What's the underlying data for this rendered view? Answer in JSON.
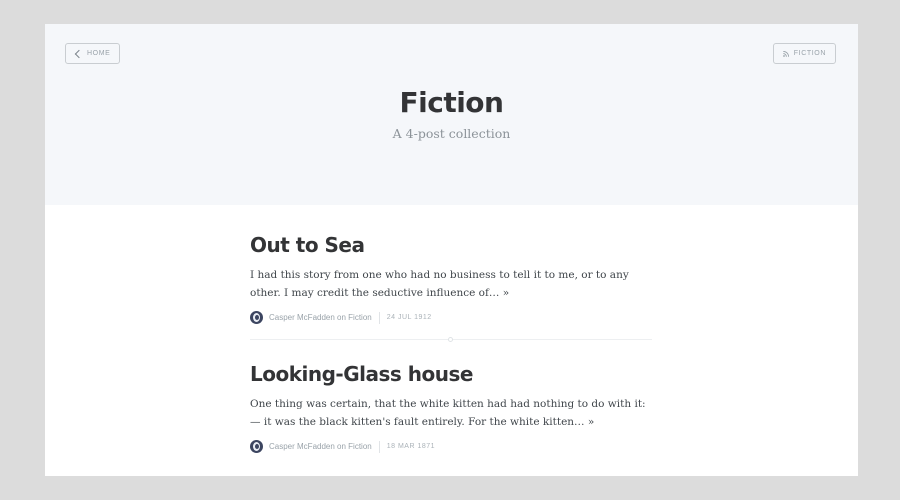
{
  "nav": {
    "home_label": "Home",
    "tag_label": "Fiction"
  },
  "header": {
    "title": "Fiction",
    "description": "A 4-post collection"
  },
  "posts": [
    {
      "title": "Out to Sea",
      "excerpt": "I had this story from one who had no business to tell it to me, or to any other. I may credit the seductive influence of…",
      "more": "»",
      "author_line": "Casper McFadden on Fiction",
      "date": "24 JUL 1912"
    },
    {
      "title": "Looking-Glass house",
      "excerpt": "One thing was certain, that the white kitten had had nothing to do with it:— it was the black kitten's fault entirely. For the white kitten…",
      "more": "»",
      "author_line": "Casper McFadden on Fiction",
      "date": "18 MAR 1871"
    }
  ],
  "colors": {
    "page_bg": "#dcdcdc",
    "header_bg": "#f5f7fa",
    "title": "#333436",
    "muted": "#9aa3aa"
  },
  "icons": {
    "home": "chevron-left-icon",
    "tag": "rss-icon",
    "avatar": "avatar"
  }
}
